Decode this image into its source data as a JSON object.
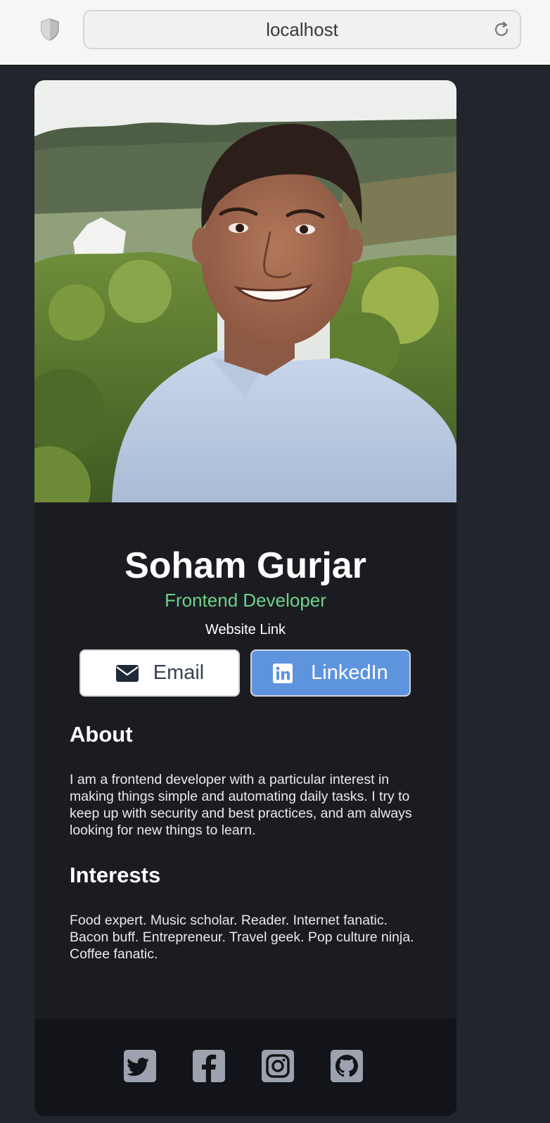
{
  "browser": {
    "url": "localhost"
  },
  "profile": {
    "name": "Soham Gurjar",
    "role": "Frontend Developer",
    "website_label": "Website Link"
  },
  "buttons": {
    "email_label": "Email",
    "linkedin_label": "LinkedIn"
  },
  "about": {
    "title": "About",
    "text": "I am a frontend developer with a particular interest in making things simple and automating daily tasks. I try to keep up with security and best practices, and am always looking for new things to learn."
  },
  "interests": {
    "title": "Interests",
    "text": "Food expert. Music scholar. Reader. Internet fanatic. Bacon buff. Entrepreneur. Travel geek. Pop culture ninja. Coffee fanatic."
  },
  "social": {
    "icons": [
      "twitter-icon",
      "facebook-icon",
      "instagram-icon",
      "github-icon"
    ]
  },
  "colors": {
    "page_bg": "#23252c",
    "card_bg": "#1b1c21",
    "footer_bg": "#131419",
    "accent_green": "#6fd28a",
    "linkedin_blue": "#5e93dd"
  }
}
